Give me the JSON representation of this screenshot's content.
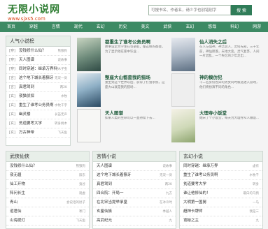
{
  "site": {
    "name": "无限小说网",
    "url": "www.sjxs5.com"
  },
  "search": {
    "placeholder": "可搜书名、作者名，请少字也别错别字",
    "button": "搜 索"
  },
  "nav": [
    "首页",
    "穿越",
    "言情",
    "现代",
    "玄幻",
    "历史",
    "美文",
    "武侠",
    "玄幻",
    "悠哉",
    "科幻",
    "网游"
  ],
  "hot": {
    "title": "人气小说榜",
    "items": [
      {
        "cat": "[穿]",
        "name": "没钱修什么仙？",
        "author": "熊狼狗"
      },
      {
        "cat": "[穿]",
        "name": "天人图谱",
        "author": "说故事"
      },
      {
        "cat": "[穿]",
        "name": "同时穿越：继承万界科技",
        "author": "木子虫"
      },
      {
        "cat": "[言]",
        "name": "这个地下城长着獠牙",
        "author": "无双一剑"
      },
      {
        "cat": "[言]",
        "name": "真君驾到",
        "author": "两2K"
      },
      {
        "cat": "[玄]",
        "name": "夜猫侦探",
        "author": "水牧"
      },
      {
        "cat": "[玄]",
        "name": "重生了谁考公务员啊",
        "author": "水牧千字"
      },
      {
        "cat": "[玄]",
        "name": "幽灵楼",
        "author": "长笛无声"
      },
      {
        "cat": "[玄]",
        "name": "贫道要考大学",
        "author": "转身桃木"
      },
      {
        "cat": "[玄]",
        "name": "万古神帝",
        "author": "飞天鱼"
      }
    ]
  },
  "features": [
    {
      "title": "都重生了谁考公务员啊",
      "desc": "故事设定为学生在等录取，都这样的都会，为了显示他在家中毕业..."
    },
    {
      "title": "仙人消失之后",
      "desc": "在人与仙神，神之后人，灵何先知，三千年前，神仙陨落，天地大变，灵气复苏，人间一片混乱，一个失忆的少年走出..."
    },
    {
      "title": "整座大山都是我的猎场",
      "desc": "重生到这个世界以后，获得了打猎系统，这座大山就是我的猎场..."
    },
    {
      "title": "神的模仿犯",
      "desc": "十二名身份各异的男女同时被选进入游戏，他们将扮演不同的角色..."
    },
    {
      "title": "天人图谱",
      "desc": "如果人类的生命可以一直持续下去..."
    },
    {
      "title": "大理寺小饭堂",
      "desc": "她宋了个小饭堂，每天为大理寺众人做饭..."
    }
  ],
  "sections": [
    {
      "title": "武侠仙侠",
      "items": [
        {
          "name": "没钱修什么仙？",
          "author": "熊狼狗"
        },
        {
          "name": "夜无疆",
          "author": "辰东"
        },
        {
          "name": "仙工开物",
          "author": "鬼谷"
        },
        {
          "name": "阵问长生",
          "author": "观虚"
        },
        {
          "name": "青山",
          "author": "会说话的肘子"
        },
        {
          "name": "道君仙",
          "author": "寒门"
        },
        {
          "name": "山海提灯",
          "author": "飞天鱼"
        }
      ]
    },
    {
      "title": "言情小说",
      "items": [
        {
          "name": "天人图谱",
          "author": "说故事"
        },
        {
          "name": "这个地下城长着獠牙",
          "author": "无双一剑"
        },
        {
          "name": "真君驾到",
          "author": "两2K"
        },
        {
          "name": "四合院：开局一",
          "author": "九方"
        },
        {
          "name": "在北宋当提举承皇",
          "author": "在冰冷时"
        },
        {
          "name": "玄鉴仙族",
          "author": "季越人"
        },
        {
          "name": "高武纪元",
          "author": "九"
        }
      ]
    },
    {
      "title": "玄幻小说",
      "items": [
        {
          "name": "同时穿越：继承万界",
          "author": "虚有"
        },
        {
          "name": "重生了谁考公务员啊",
          "author": "水牧千"
        },
        {
          "name": "贫道要考大学",
          "author": "转身"
        },
        {
          "name": "谁让他修仙的！",
          "author": "最白的乌鸦"
        },
        {
          "name": "大明第一国舅",
          "author": "一马"
        },
        {
          "name": "超神卡牌师",
          "author": "我是三"
        },
        {
          "name": "诡秘之主",
          "author": "九"
        }
      ]
    }
  ]
}
